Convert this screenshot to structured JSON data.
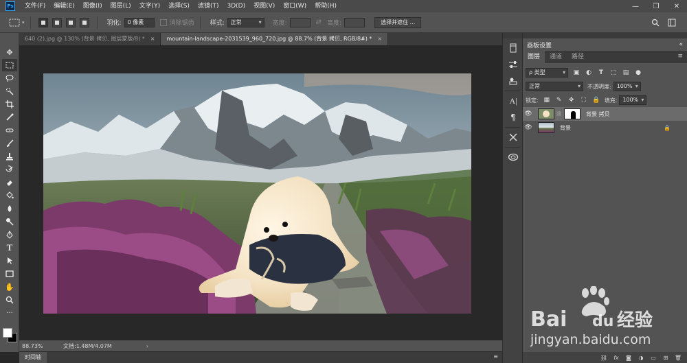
{
  "app": {
    "logo": "Ps"
  },
  "menu": [
    "文件(F)",
    "编辑(E)",
    "图像(I)",
    "图层(L)",
    "文字(Y)",
    "选择(S)",
    "滤镜(T)",
    "3D(D)",
    "视图(V)",
    "窗口(W)",
    "帮助(H)"
  ],
  "window_controls": {
    "minimize": "—",
    "restore": "❐",
    "close": "✕"
  },
  "options": {
    "feather_label": "羽化:",
    "feather_value": "0 像素",
    "antialias_label": "消除锯齿",
    "style_label": "样式:",
    "style_value": "正常",
    "width_label": "宽度:",
    "height_label": "高度:",
    "select_mask_button": "选择并遮住 ..."
  },
  "tabs": [
    {
      "label": "640 (2).jpg @ 130% (背景 拷贝, 图层蒙版/8) *",
      "close": "×"
    },
    {
      "label": "mountain-landscape-2031539_960_720.jpg @ 88.7% (背景 拷贝, RGB/8#) *",
      "close": "×"
    }
  ],
  "status": {
    "zoom": "88.73%",
    "doc": "文档:1.48M/4.07M",
    "arrow": "›"
  },
  "timeline": {
    "label": "时间轴",
    "menu": "≡"
  },
  "panel": {
    "header": "画板设置",
    "header_menu": "«",
    "tabs": [
      "图层",
      "通道",
      "路径"
    ],
    "tabs_menu": "≡",
    "filter_type": "ρ 类型",
    "blend_mode": "正常",
    "opacity_label": "不透明度:",
    "opacity_value": "100%",
    "lock_label": "锁定:",
    "fill_label": "填充:",
    "fill_value": "100%",
    "layers": [
      {
        "name": "背景 拷贝",
        "selected": true
      },
      {
        "name": "背景",
        "selected": false
      }
    ]
  },
  "colors": {
    "accent": "#31a8ff",
    "panel": "#535353",
    "dark": "#282828"
  },
  "watermark": {
    "brand_top": "Bai",
    "brand_du": "du",
    "brand_cn": "经验",
    "url": "jingyan.baidu.com"
  }
}
